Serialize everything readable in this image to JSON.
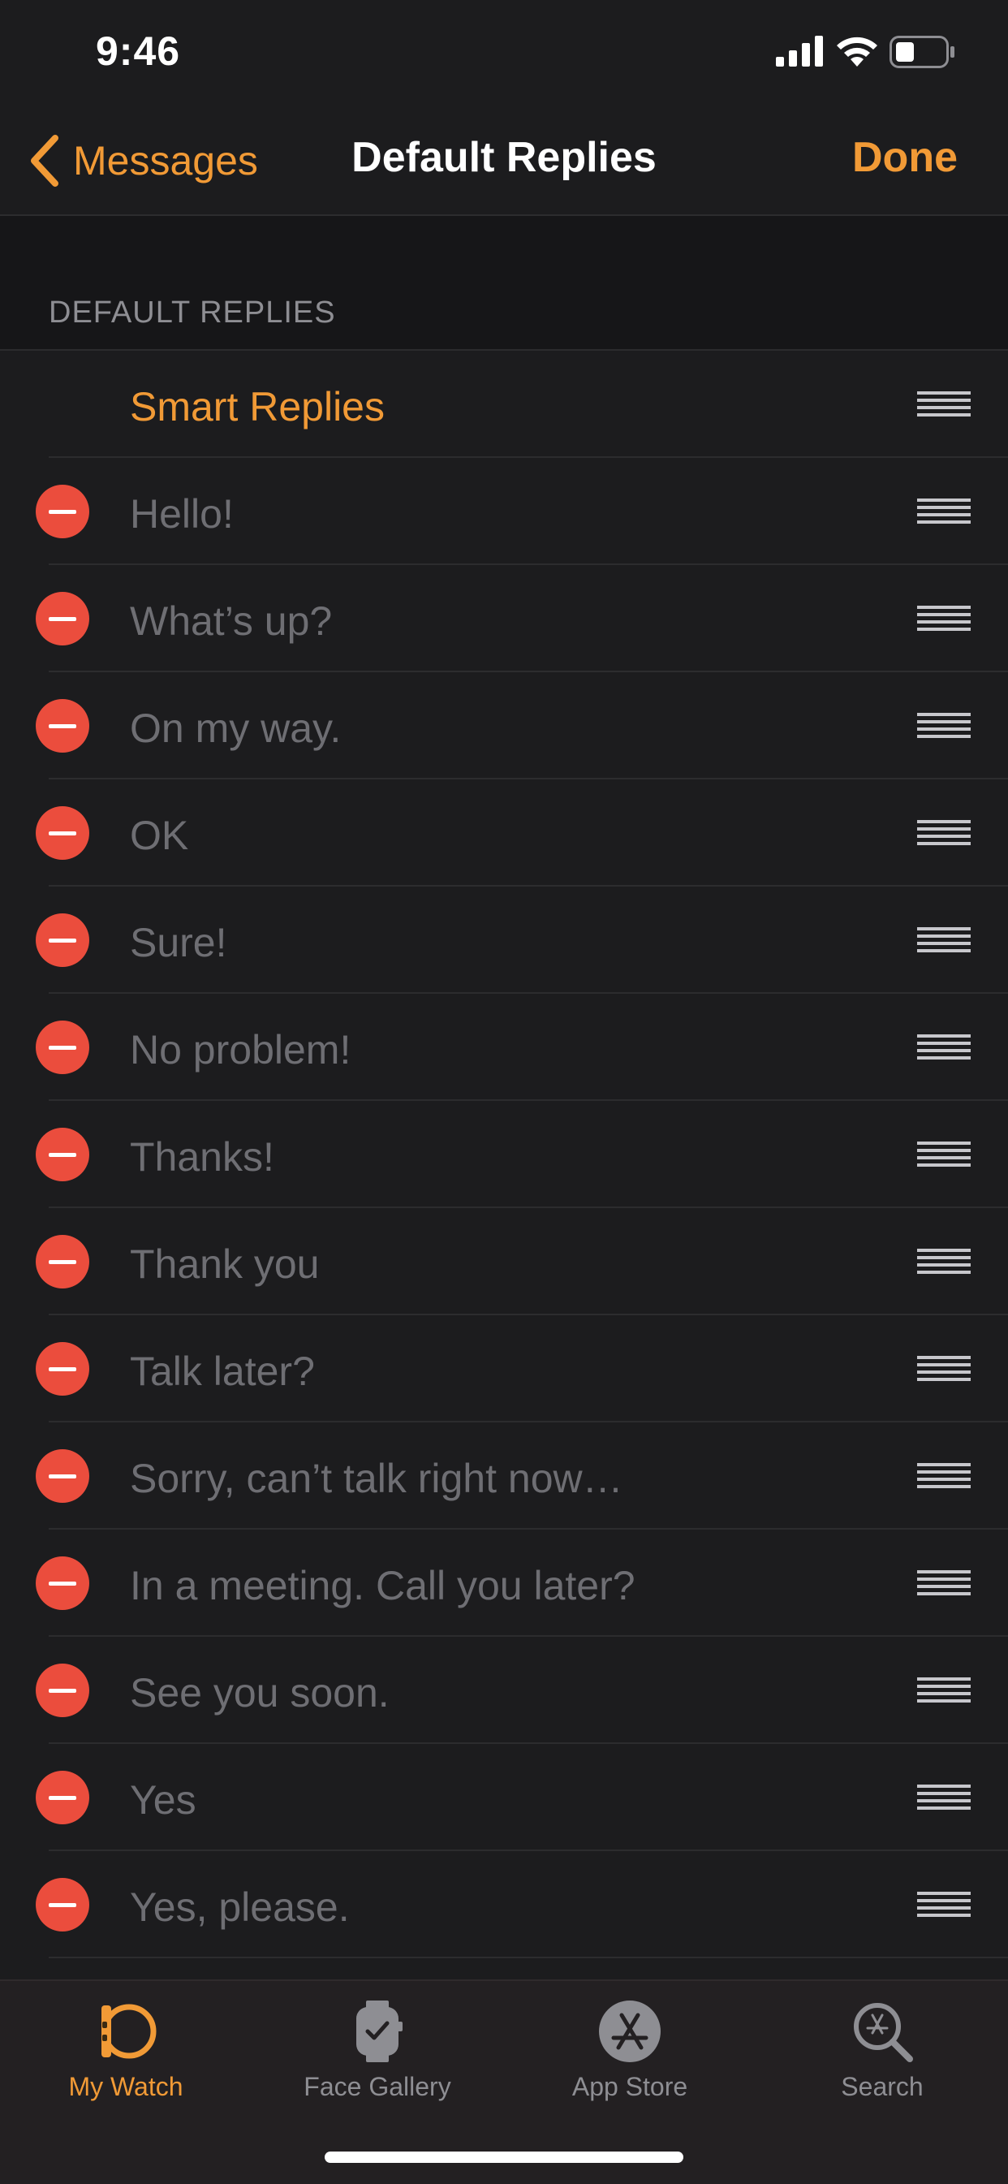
{
  "status_bar": {
    "time": "9:46"
  },
  "nav": {
    "back_label": "Messages",
    "title": "Default Replies",
    "done_label": "Done"
  },
  "section": {
    "header": "DEFAULT REPLIES"
  },
  "smart_replies_label": "Smart Replies",
  "replies": [
    "Hello!",
    "What’s up?",
    "On my way.",
    "OK",
    "Sure!",
    "No problem!",
    "Thanks!",
    "Thank you",
    "Talk later?",
    "Sorry, can’t talk right now…",
    "In a meeting. Call you later?",
    "See you soon.",
    "Yes",
    "Yes, please."
  ],
  "tabs": [
    {
      "label": "My Watch",
      "icon": "watch-icon",
      "active": true
    },
    {
      "label": "Face Gallery",
      "icon": "face-gallery-icon",
      "active": false
    },
    {
      "label": "App Store",
      "icon": "app-store-icon",
      "active": false
    },
    {
      "label": "Search",
      "icon": "search-icon",
      "active": false
    }
  ],
  "colors": {
    "accent": "#f19a36",
    "delete": "#eb4d3d",
    "background": "#1c1c1e",
    "muted_text": "#6e6e73"
  }
}
